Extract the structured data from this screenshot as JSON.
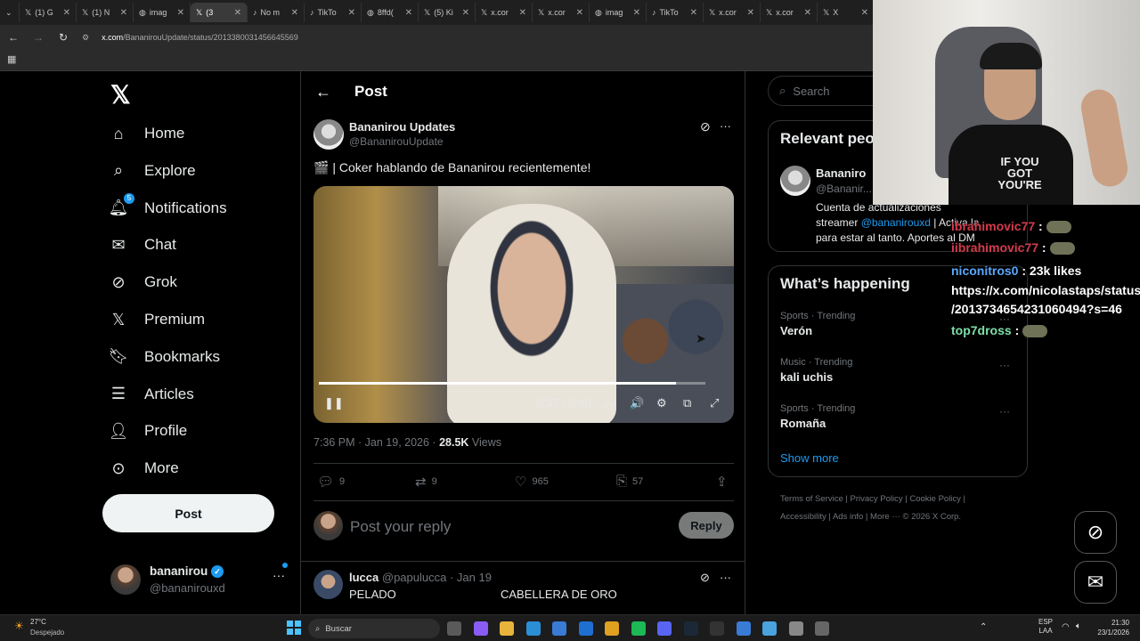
{
  "browser": {
    "tabs": [
      {
        "label": "(1) G",
        "icon": "x-icon"
      },
      {
        "label": "(1) N",
        "icon": "x-icon"
      },
      {
        "label": "imag",
        "icon": "globe-icon"
      },
      {
        "label": "(3",
        "icon": "x-icon",
        "active": true
      },
      {
        "label": "No m",
        "icon": "tiktok-icon"
      },
      {
        "label": "TikTo",
        "icon": "tiktok-icon"
      },
      {
        "label": "8ffd(",
        "icon": "globe-icon"
      },
      {
        "label": "(5) Ki",
        "icon": "x-icon"
      },
      {
        "label": "x.cor",
        "icon": "x-icon"
      },
      {
        "label": "x.cor",
        "icon": "x-icon"
      },
      {
        "label": "imag",
        "icon": "globe-icon"
      },
      {
        "label": "TikTo",
        "icon": "tiktok-icon"
      },
      {
        "label": "x.cor",
        "icon": "x-icon"
      },
      {
        "label": "x.cor",
        "icon": "x-icon"
      },
      {
        "label": "X",
        "icon": "x-icon"
      }
    ],
    "url_domain": "x.com",
    "url_path": "/BananirouUpdate/status/2013380031456645569"
  },
  "nav": {
    "items": [
      {
        "label": "Home",
        "icon": "home-icon",
        "name": "nav-home"
      },
      {
        "label": "Explore",
        "icon": "search-icon",
        "name": "nav-explore"
      },
      {
        "label": "Notifications",
        "icon": "bell-icon",
        "name": "nav-notifications",
        "badge": "5"
      },
      {
        "label": "Chat",
        "icon": "mail-icon",
        "name": "nav-chat"
      },
      {
        "label": "Grok",
        "icon": "grok-icon",
        "name": "nav-grok"
      },
      {
        "label": "Premium",
        "icon": "x-icon",
        "name": "nav-premium"
      },
      {
        "label": "Bookmarks",
        "icon": "bookmark-icon",
        "name": "nav-bookmarks"
      },
      {
        "label": "Articles",
        "icon": "article-icon",
        "name": "nav-articles"
      },
      {
        "label": "Profile",
        "icon": "person-icon",
        "name": "nav-profile"
      },
      {
        "label": "More",
        "icon": "more-circle-icon",
        "name": "nav-more"
      }
    ],
    "post_button": "Post",
    "account": {
      "name": "bananirou",
      "handle": "@bananirouxd"
    }
  },
  "post": {
    "header_title": "Post",
    "author_name": "Bananirou Updates",
    "author_handle": "@BananirouUpdate",
    "text": "🎬 | Coker hablando de Bananirou recientemente!",
    "video": {
      "time": "0:37 / 0:40",
      "progress_fraction": 0.925
    },
    "time": "7:36 PM · Jan 19, 2026 · ",
    "views_count": "28.5K",
    "views_label": " Views",
    "replies": "9",
    "reposts": "9",
    "likes": "965",
    "bookmarks": "57",
    "reply_placeholder": "Post your reply",
    "reply_button": "Reply"
  },
  "reply": {
    "name": "lucca",
    "handle_date": "@papulucca · Jan 19",
    "text_a": "PELADO",
    "text_b": "CABELLERA DE ORO"
  },
  "sidebar": {
    "search_placeholder": "Search",
    "relevant_title": "Relevant peo",
    "relevant_name": "Bananiro",
    "relevant_handle": "@Bananir...",
    "relevant_bio_1": "Cuenta de actualizaciones",
    "relevant_bio_2a": "streamer ",
    "relevant_bio_link": "@bananirouxd",
    "relevant_bio_2b": " | Activa la",
    "relevant_bio_3": "para estar al tanto. Aportes al DM",
    "happening_title": "What’s happening",
    "trends": [
      {
        "cat": "Sports · Trending",
        "topic": "Verón"
      },
      {
        "cat": "Music · Trending",
        "topic": "kali uchis"
      },
      {
        "cat": "Sports · Trending",
        "topic": "Romaña"
      }
    ],
    "show_more": "Show more",
    "footer_1": "Terms of Service  |  Privacy Policy  |  Cookie Policy  |",
    "footer_2": "Accessibility  |  Ads info  |  More ···  © 2026 X Corp."
  },
  "overlay": {
    "shirt_text": "IF YOU GOT YOU'RE",
    "chat": [
      {
        "user": "ibrahimovic77",
        "sep": " : ",
        "text": ""
      },
      {
        "user": "iibrahimovic77",
        "sep": " : ",
        "text": ""
      },
      {
        "user": "niconitros0",
        "sep": " : ",
        "text": "23k likes"
      },
      {
        "user": "",
        "sep": "",
        "text": "https://x.com/nicolastaps/status"
      },
      {
        "user": "",
        "sep": "",
        "text": "/2013734654231060494?s=46"
      },
      {
        "user": "top7dross",
        "sep": " : ",
        "text": ""
      }
    ]
  },
  "taskbar": {
    "weather_temp": "27°C",
    "weather_desc": "Despejado",
    "search_label": "Buscar",
    "lang_1": "ESP",
    "lang_2": "LAA",
    "time": "21:30",
    "date": "23/1/2026"
  },
  "colors": {
    "accent": "#1d9bf0",
    "chat_red": "#d43c4d",
    "chat_blue": "#5aa8ff",
    "chat_green": "#7ee0a8"
  }
}
